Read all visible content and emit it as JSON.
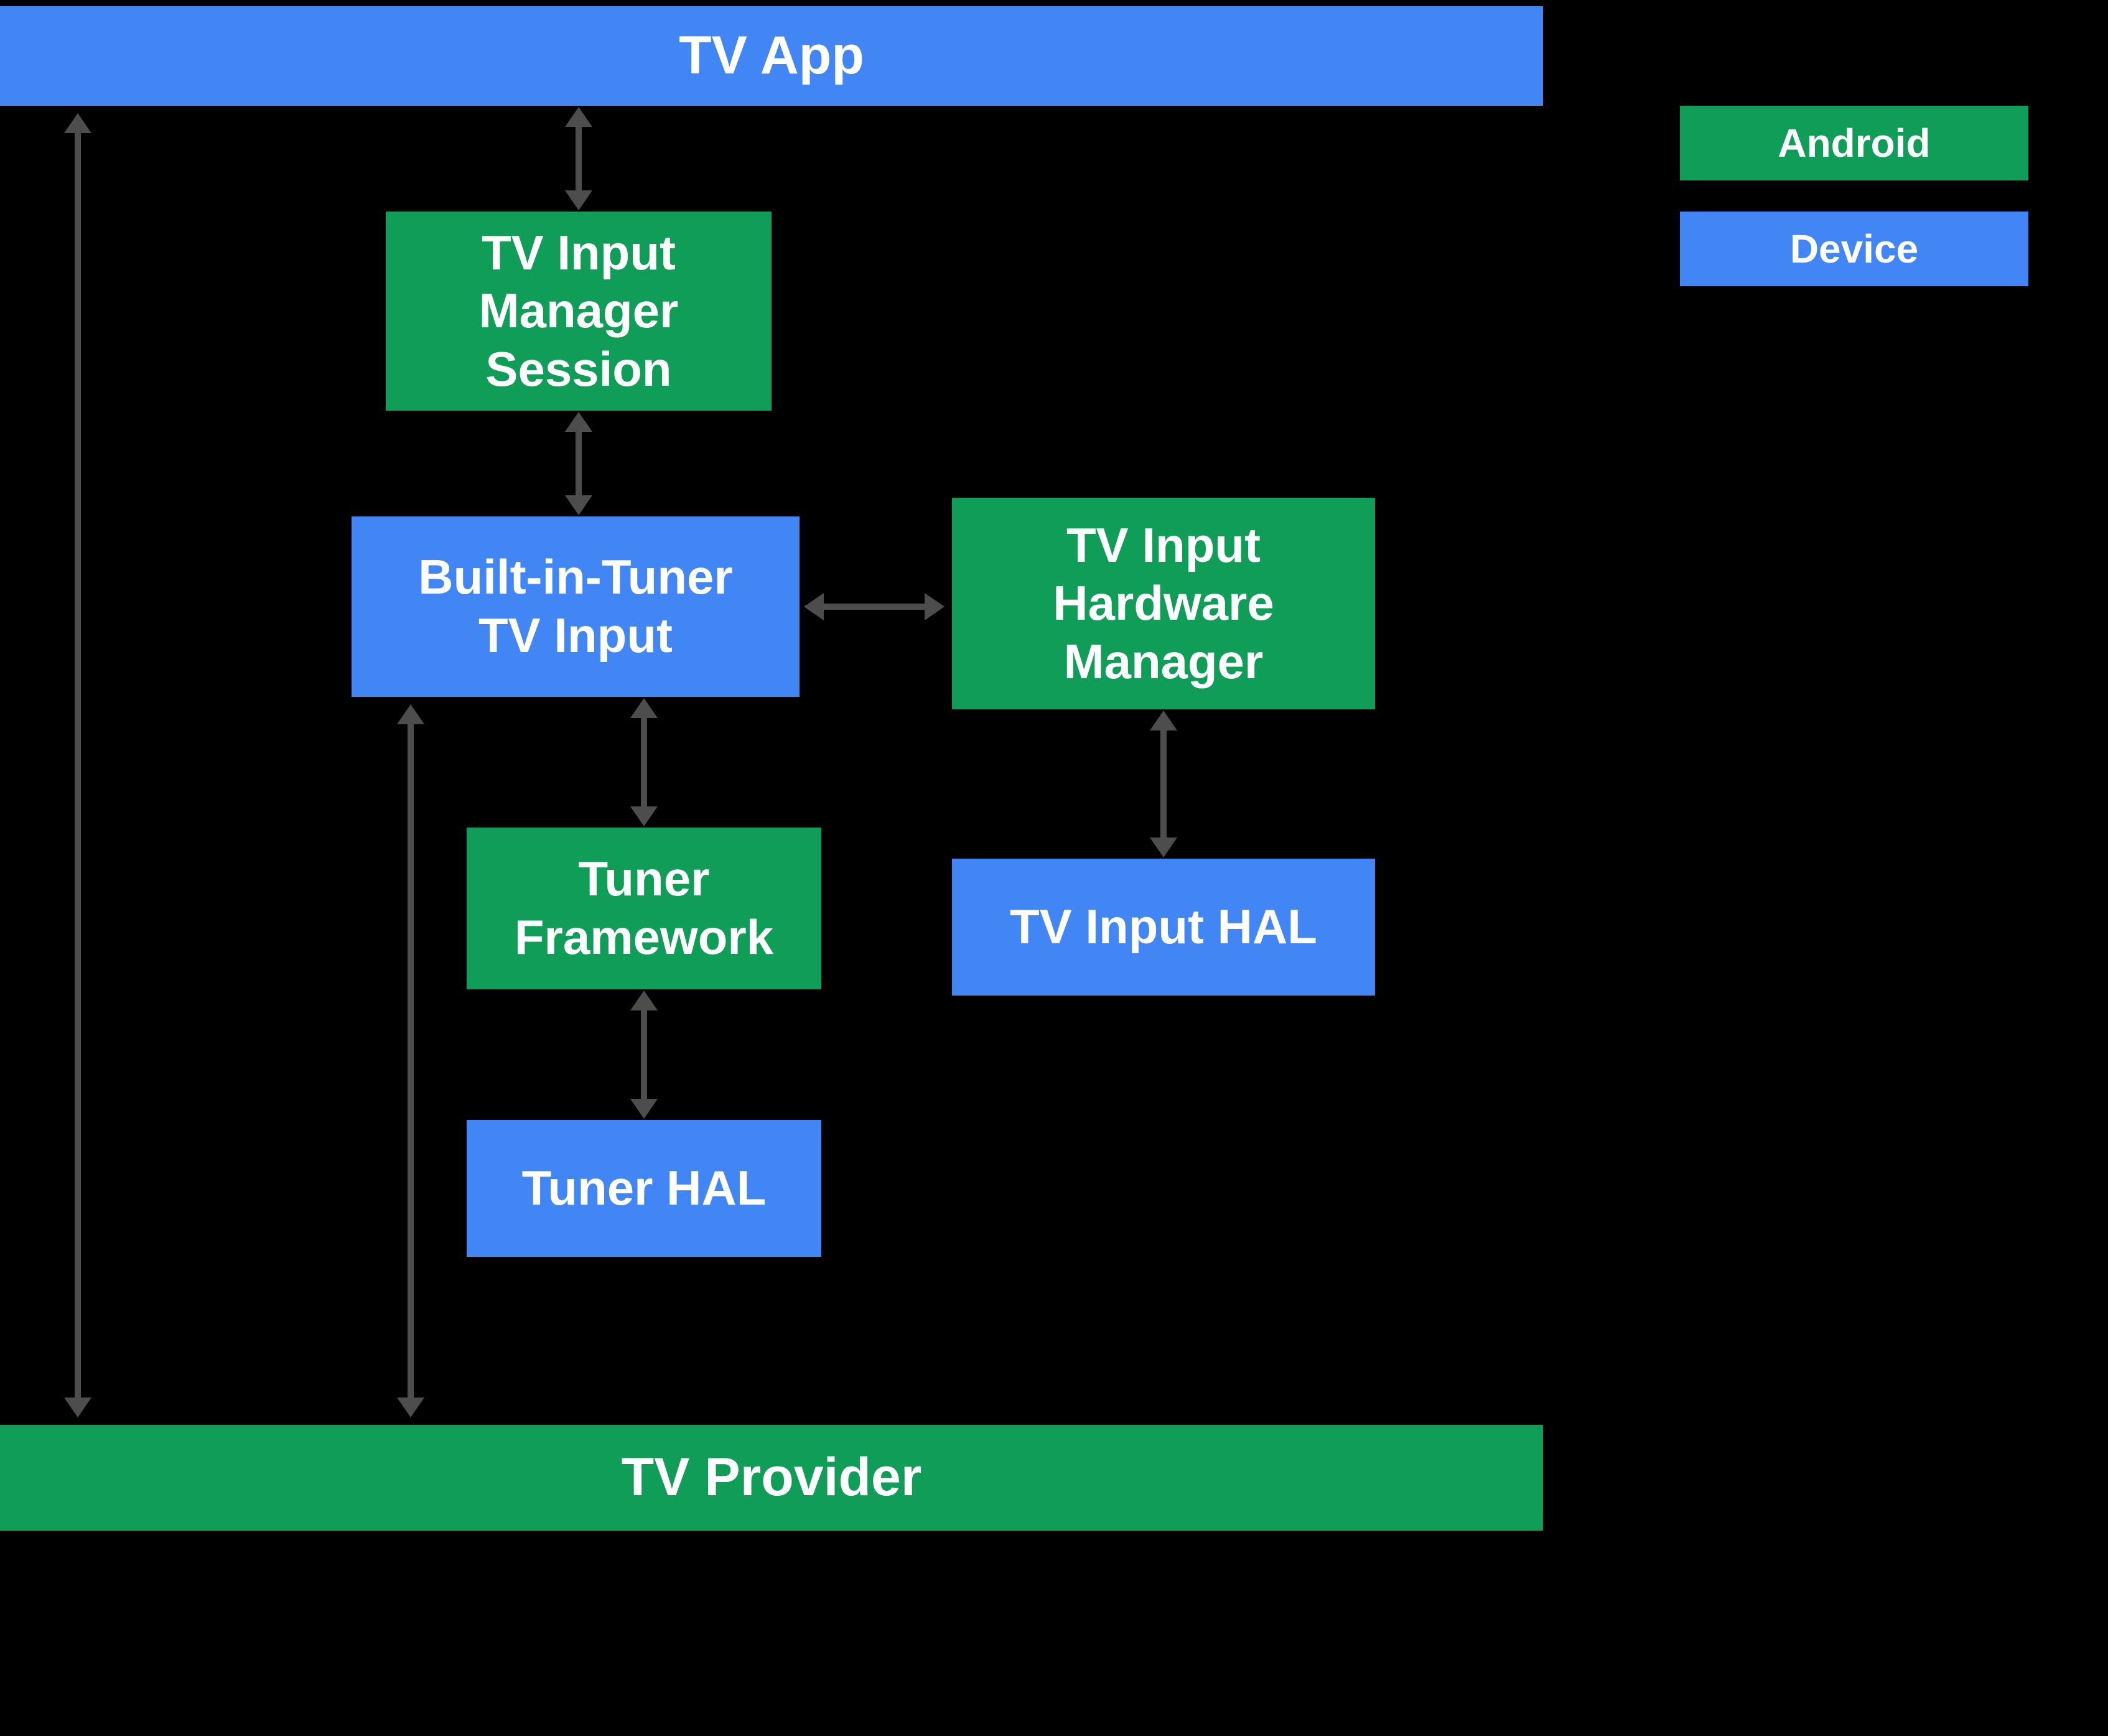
{
  "colors": {
    "android": "#0f9d58",
    "device": "#4285f4",
    "arrow": "#4d4d4d"
  },
  "legend": {
    "android": "Android",
    "device": "Device"
  },
  "nodes": {
    "tv_app": {
      "label": "TV App",
      "kind": "device"
    },
    "tvim_session": {
      "label": "TV Input\nManager\nSession",
      "kind": "android"
    },
    "builtin_tuner": {
      "label": "Built-in-Tuner\nTV Input",
      "kind": "device"
    },
    "tvi_hw_manager": {
      "label": "TV Input\nHardware\nManager",
      "kind": "android"
    },
    "tuner_framework": {
      "label": "Tuner\nFramework",
      "kind": "android"
    },
    "tv_input_hal": {
      "label": "TV Input HAL",
      "kind": "device"
    },
    "tuner_hal": {
      "label": "Tuner HAL",
      "kind": "device"
    },
    "tv_provider": {
      "label": "TV Provider",
      "kind": "android"
    }
  },
  "edges": [
    [
      "tv_app",
      "tvim_session"
    ],
    [
      "tvim_session",
      "builtin_tuner"
    ],
    [
      "builtin_tuner",
      "tvi_hw_manager"
    ],
    [
      "builtin_tuner",
      "tuner_framework"
    ],
    [
      "tvi_hw_manager",
      "tv_input_hal"
    ],
    [
      "tuner_framework",
      "tuner_hal"
    ],
    [
      "tv_app",
      "tv_provider"
    ],
    [
      "builtin_tuner",
      "tv_provider"
    ]
  ]
}
